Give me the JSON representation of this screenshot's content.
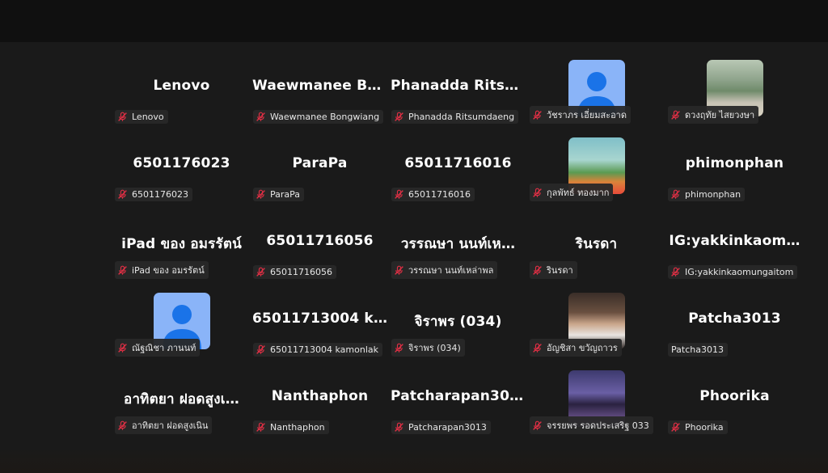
{
  "meeting": {
    "participants": [
      {
        "title": "Lenovo",
        "label": "Lenovo",
        "muted": true,
        "avatar": "none"
      },
      {
        "title": "Waewmanee Bo…",
        "label": "Waewmanee Bongwiang",
        "muted": true,
        "avatar": "none"
      },
      {
        "title": "Phanadda Ritsu…",
        "label": "Phanadda Ritsumdaeng",
        "muted": true,
        "avatar": "none"
      },
      {
        "title": "",
        "label": "วัชราภร เอี่ยมสะอาด",
        "muted": true,
        "avatar": "default"
      },
      {
        "title": "",
        "label": "ดวงฤทัย ไสยวงษา",
        "muted": true,
        "avatar": "photo-girl"
      },
      {
        "title": "6501176023",
        "label": "6501176023",
        "muted": true,
        "avatar": "none"
      },
      {
        "title": "ParaPa",
        "label": "ParaPa",
        "muted": true,
        "avatar": "none"
      },
      {
        "title": "65011716016",
        "label": "65011716016",
        "muted": true,
        "avatar": "none"
      },
      {
        "title": "",
        "label": "กุลพัทธ์ ทองมาก",
        "muted": true,
        "avatar": "photo-art"
      },
      {
        "title": "phimonphan",
        "label": "phimonphan",
        "muted": true,
        "avatar": "none"
      },
      {
        "title": "iPad ของ อมรรัตน์",
        "label": "iPad ของ อมรรัตน์",
        "muted": true,
        "avatar": "none"
      },
      {
        "title": "65011716056",
        "label": "65011716056",
        "muted": true,
        "avatar": "none"
      },
      {
        "title": "วรรณษา นนท์เห…",
        "label": "วรรณษา นนท์เหล่าพล",
        "muted": true,
        "avatar": "none"
      },
      {
        "title": "รินรดา",
        "label": "รินรดา",
        "muted": true,
        "avatar": "none"
      },
      {
        "title": "IG:yakkinkaom…",
        "label": "IG:yakkinkaomungaitom",
        "muted": true,
        "avatar": "none"
      },
      {
        "title": "",
        "label": "ณัฐณิชา ภานนท์",
        "muted": true,
        "avatar": "default"
      },
      {
        "title": "65011713004 k…",
        "label": "65011713004 kamonlak",
        "muted": true,
        "avatar": "none"
      },
      {
        "title": "จิราพร (034)",
        "label": "จิราพร (034)",
        "muted": true,
        "avatar": "none"
      },
      {
        "title": "",
        "label": "อัญชิสา ขวัญถาวร",
        "muted": true,
        "avatar": "photo-selfie"
      },
      {
        "title": "Patcha3013",
        "label": "Patcha3013",
        "muted": false,
        "avatar": "none"
      },
      {
        "title": "อาทิตยา ฝอดสูงเ…",
        "label": "อาทิตยา ฝอดสูงเนิน",
        "muted": true,
        "avatar": "none"
      },
      {
        "title": "Nanthaphon",
        "label": "Nanthaphon",
        "muted": true,
        "avatar": "none"
      },
      {
        "title": "Patcharapan3013",
        "label": "Patcharapan3013",
        "muted": true,
        "avatar": "none"
      },
      {
        "title": "",
        "label": "จรรยพร รอดประเสริฐ 033",
        "muted": true,
        "avatar": "photo-anime"
      },
      {
        "title": "Phoorika",
        "label": "Phoorika",
        "muted": true,
        "avatar": "none"
      }
    ]
  },
  "colors": {
    "background": "#1a1a1a",
    "mute_icon": "#e02f44",
    "default_avatar": "#8ab4f8"
  },
  "icons": {
    "mute": "mic-off-icon",
    "default_avatar": "person-icon"
  }
}
